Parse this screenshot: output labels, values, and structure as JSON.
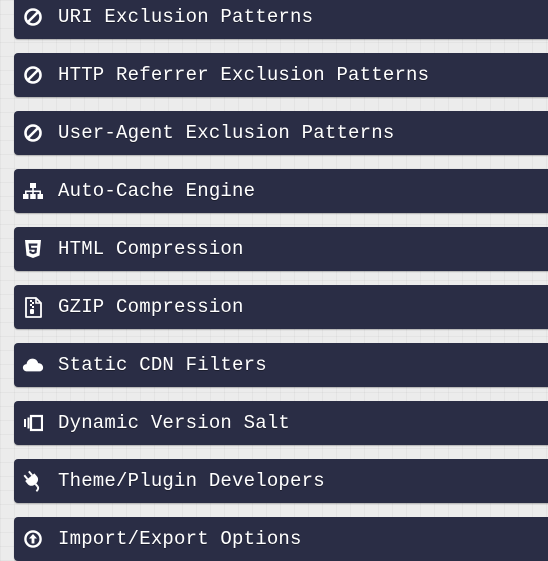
{
  "panels": [
    {
      "label": "URI Exclusion Patterns",
      "icon": "ban-icon"
    },
    {
      "label": "HTTP Referrer Exclusion Patterns",
      "icon": "ban-icon"
    },
    {
      "label": "User-Agent Exclusion Patterns",
      "icon": "ban-icon"
    },
    {
      "label": "Auto-Cache Engine",
      "icon": "sitemap-icon"
    },
    {
      "label": "HTML Compression",
      "icon": "html5-icon"
    },
    {
      "label": "GZIP Compression",
      "icon": "file-archive-icon"
    },
    {
      "label": "Static CDN Filters",
      "icon": "cloud-icon"
    },
    {
      "label": "Dynamic Version Salt",
      "icon": "version-salt-icon"
    },
    {
      "label": "Theme/Plugin Developers",
      "icon": "plug-icon"
    },
    {
      "label": "Import/Export Options",
      "icon": "circle-arrow-up-icon"
    }
  ],
  "colors": {
    "panel_bg": "#2a2d45",
    "text": "#ffffff",
    "page_bg": "#ececec"
  }
}
